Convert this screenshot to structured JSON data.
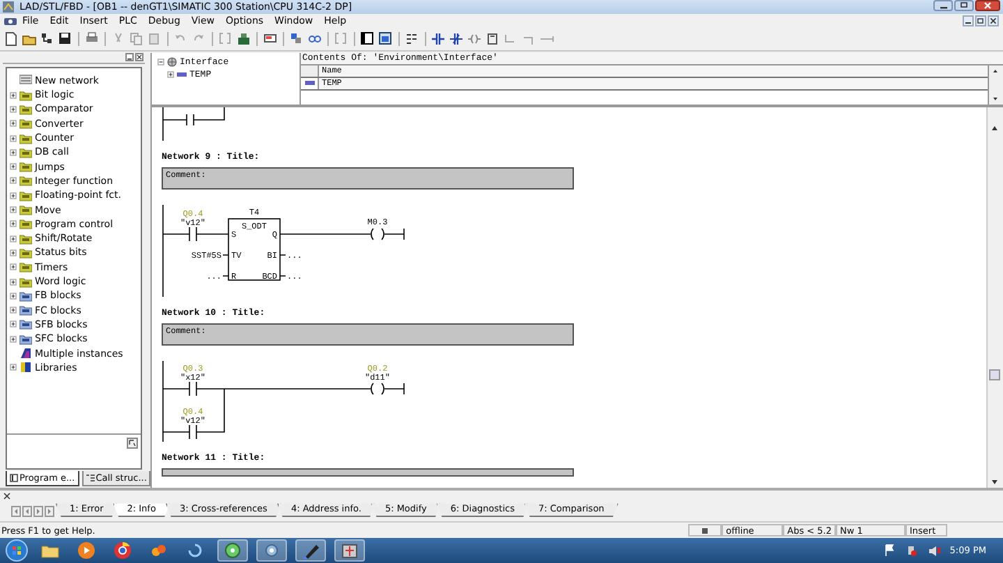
{
  "window": {
    "title": "LAD/STL/FBD  - [OB1 -- denGT1\\SIMATIC 300 Station\\CPU 314C-2 DP]"
  },
  "menu": [
    "File",
    "Edit",
    "Insert",
    "PLC",
    "Debug",
    "View",
    "Options",
    "Window",
    "Help"
  ],
  "catalog": {
    "items": [
      {
        "label": "New network",
        "kind": "network",
        "expandable": false
      },
      {
        "label": "Bit logic",
        "kind": "folder",
        "expandable": true
      },
      {
        "label": "Comparator",
        "kind": "folder",
        "expandable": true
      },
      {
        "label": "Converter",
        "kind": "folder",
        "expandable": true
      },
      {
        "label": "Counter",
        "kind": "folder",
        "expandable": true
      },
      {
        "label": "DB call",
        "kind": "folder",
        "expandable": true
      },
      {
        "label": "Jumps",
        "kind": "folder",
        "expandable": true
      },
      {
        "label": "Integer function",
        "kind": "folder",
        "expandable": true
      },
      {
        "label": "Floating-point fct.",
        "kind": "folder",
        "expandable": true
      },
      {
        "label": "Move",
        "kind": "folder",
        "expandable": true
      },
      {
        "label": "Program control",
        "kind": "folder",
        "expandable": true
      },
      {
        "label": "Shift/Rotate",
        "kind": "folder",
        "expandable": true
      },
      {
        "label": "Status bits",
        "kind": "folder",
        "expandable": true
      },
      {
        "label": "Timers",
        "kind": "folder",
        "expandable": true
      },
      {
        "label": "Word logic",
        "kind": "folder",
        "expandable": true
      },
      {
        "label": "FB blocks",
        "kind": "blocks",
        "expandable": true
      },
      {
        "label": "FC blocks",
        "kind": "blocks",
        "expandable": true
      },
      {
        "label": "SFB blocks",
        "kind": "blocks",
        "expandable": true
      },
      {
        "label": "SFC blocks",
        "kind": "blocks",
        "expandable": true
      },
      {
        "label": "Multiple instances",
        "kind": "instances",
        "expandable": false
      },
      {
        "label": "Libraries",
        "kind": "library",
        "expandable": true
      }
    ],
    "tabs": [
      {
        "label": "Program e...",
        "selected": true
      },
      {
        "label": "Call struc...",
        "selected": false
      }
    ]
  },
  "interface": {
    "tree": {
      "label": "Interface",
      "expanded": true,
      "children": [
        {
          "label": "TEMP",
          "expanded": false
        }
      ]
    },
    "contents_title": "Contents Of: 'Environment\\Interface'",
    "columns": [
      "Name"
    ],
    "rows": [
      "TEMP"
    ]
  },
  "networks": [
    {
      "title": "Network 9 : Title:",
      "comment": "Comment:",
      "kind": "timer",
      "contacts": [
        {
          "address": "Q0.4",
          "symbol": "\"v12\""
        }
      ],
      "block": {
        "name": "T4",
        "type": "S_ODT",
        "inputs": [
          {
            "pin": "S"
          },
          {
            "pin": "TV",
            "param": "SST#5S"
          },
          {
            "pin": "R",
            "param": "..."
          }
        ],
        "outputs": [
          {
            "pin": "Q"
          },
          {
            "pin": "BI",
            "param": "..."
          },
          {
            "pin": "BCD",
            "param": "..."
          }
        ]
      },
      "coil": {
        "address": "M0.3"
      }
    },
    {
      "title": "Network 10 : Title:",
      "comment": "Comment:",
      "kind": "parallel",
      "contacts": [
        {
          "address": "Q0.3",
          "symbol": "\"x12\""
        },
        {
          "address": "Q0.4",
          "symbol": "\"v12\""
        }
      ],
      "coil": {
        "address": "Q0.2",
        "symbol": "\"d11\""
      }
    },
    {
      "title": "Network 11 : Title:",
      "kind": "cut"
    }
  ],
  "output_tabs": [
    {
      "label": "1: Error",
      "selected": false
    },
    {
      "label": "2: Info",
      "selected": true
    },
    {
      "label": "3: Cross-references",
      "selected": false
    },
    {
      "label": "4: Address info.",
      "selected": false
    },
    {
      "label": "5: Modify",
      "selected": false
    },
    {
      "label": "6: Diagnostics",
      "selected": false
    },
    {
      "label": "7: Comparison",
      "selected": false
    }
  ],
  "status_bar": {
    "help": "Press F1 to get Help.",
    "mode": "offline",
    "address": "Abs < 5.2",
    "network": "Nw 1",
    "input_mode": "Insert"
  },
  "taskbar": {
    "time": "5:09 PM"
  }
}
